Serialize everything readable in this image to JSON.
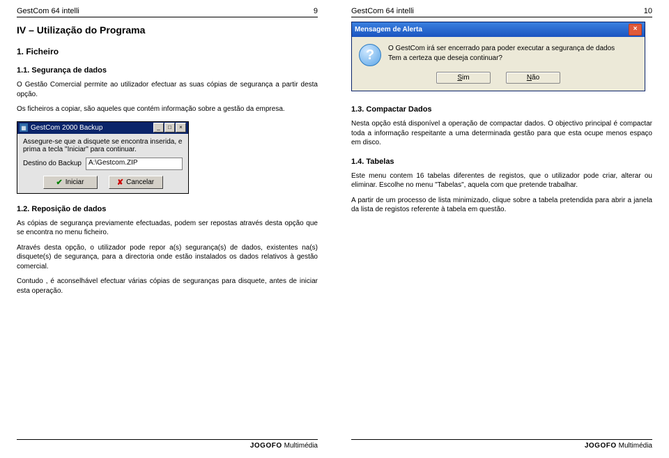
{
  "header": {
    "title": "GestCom 64 intelli"
  },
  "footer": {
    "logo": "JOGOFO",
    "text": "Multimédia"
  },
  "left": {
    "page_number": "9",
    "chapter_title": "IV – Utilização do Programa",
    "h1": "1. Ficheiro",
    "h1_1": "1.1. Segurança de dados",
    "p1": "O Gestão Comercial permite ao utilizador efectuar as suas cópias de segurança a partir desta opção.",
    "p2": "Os ficheiros a copiar, são aqueles que contém informação sobre a gestão da empresa.",
    "h1_2": "1.2. Reposição de dados",
    "p3": "As cópias de segurança previamente efectuadas, podem ser repostas através desta opção que se encontra no menu ficheiro.",
    "p4": "Através desta opção, o utilizador pode repor a(s) segurança(s) de dados, existentes na(s) disquete(s) de segurança, para a directoria onde estão instalados os dados relativos à gestão comercial.",
    "p5": "Contudo , é aconselhável efectuar várias cópias de seguranças para disquete, antes de iniciar esta operação."
  },
  "right": {
    "page_number": "10",
    "h1_3": "1.3. Compactar Dados",
    "p6": "Nesta opção está disponível a operação de compactar dados. O objectivo principal é compactar toda a informação respeitante a uma determinada gestão para que esta ocupe menos espaço em disco.",
    "h1_4": "1.4. Tabelas",
    "p7": "Este menu contem 16 tabelas diferentes de registos, que o utilizador pode criar, alterar ou eliminar. Escolhe no menu \"Tabelas\", aquela com que pretende trabalhar.",
    "p8": "A partir de um processo de lista minimizado, clique sobre a tabela pretendida para abrir a janela da lista de registos referente à tabela em questão."
  },
  "backup_dialog": {
    "title": "GestCom 2000 Backup",
    "message": "Assegure-se que a disquete se encontra inserida, e prima a tecla \"Iniciar\" para continuar.",
    "dest_label": "Destino do Backup",
    "dest_value": "A:\\Gestcom.ZIP",
    "btn_start": "Iniciar",
    "btn_cancel": "Cancelar"
  },
  "alert_dialog": {
    "title": "Mensagem de Alerta",
    "line1": "O GestCom irá ser encerrado para poder executar a segurança de dados",
    "line2": "Tem a certeza que deseja continuar?",
    "btn_yes_u": "S",
    "btn_yes_rest": "im",
    "btn_no_u": "N",
    "btn_no_rest": "ão"
  }
}
